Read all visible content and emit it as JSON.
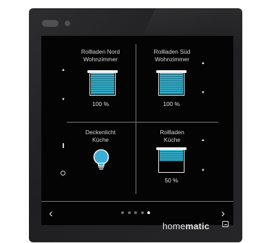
{
  "tiles": [
    {
      "name_line1": "Rollladen Nord",
      "name_line2": "Wohnzimmer",
      "value": "100 %",
      "level": 1.0,
      "up_icon": "arrow-up-icon",
      "down_icon": "arrow-down-icon"
    },
    {
      "name_line1": "Rollladen Süd",
      "name_line2": "Wohnzimmer",
      "value": "100 %",
      "level": 1.0,
      "up_icon": "arrow-up-icon",
      "down_icon": "arrow-down-icon"
    },
    {
      "name_line1": "Deckenlicht",
      "name_line2": "Küche",
      "icon": "lightbulb-icon",
      "on_icon": "toggle-on-icon",
      "off_icon": "toggle-off-icon",
      "color": "#3aaed6"
    },
    {
      "name_line1": "Rollladen",
      "name_line2": "Küche",
      "value": "50 %",
      "level": 0.5,
      "up_icon": "arrow-up-icon",
      "down_icon": "arrow-down-icon"
    }
  ],
  "navigation": {
    "prev_icon": "chevron-left-icon",
    "next_icon": "chevron-right-icon",
    "page_count": 5,
    "active_page": 5
  },
  "brand": {
    "text_regular": "home",
    "text_bold": "matic",
    "icon": "homematic-logo-icon"
  },
  "colors": {
    "accent": "#3bb9d6",
    "screen_background": "#040404",
    "housing": "#2a2a2c"
  }
}
